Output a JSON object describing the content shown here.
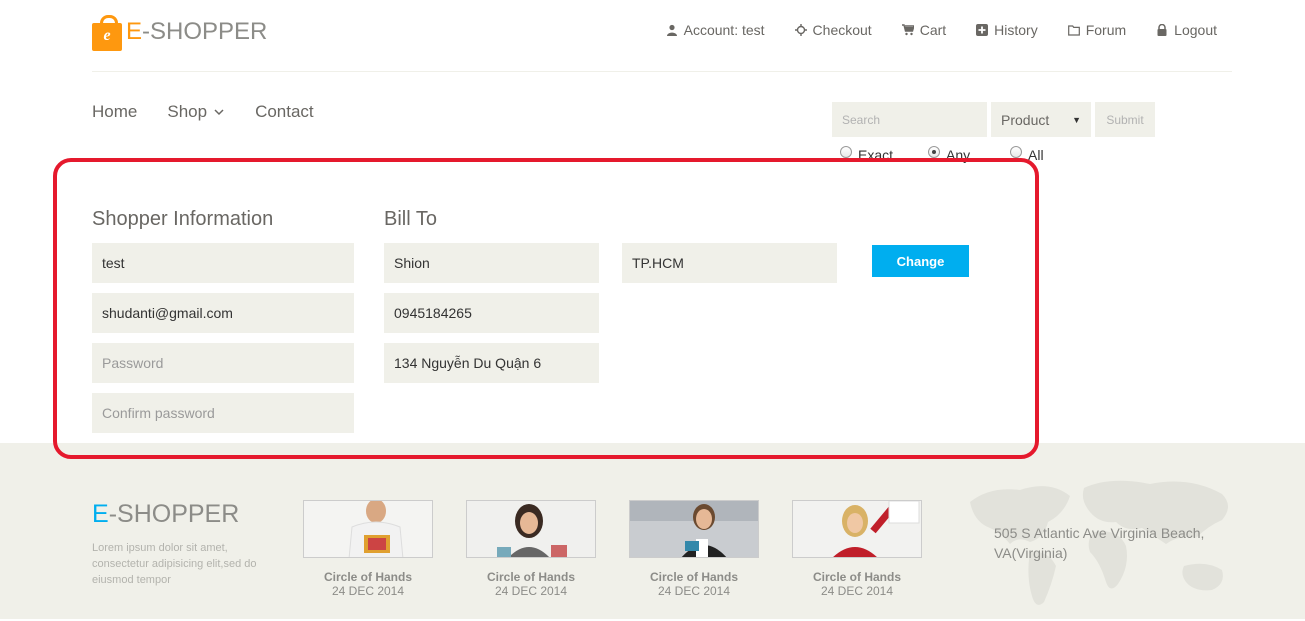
{
  "header": {
    "logo": {
      "first": "E",
      "rest": "-SHOPPER",
      "badge": "e"
    },
    "top_links": [
      {
        "label": "Account: test",
        "icon": "user-icon"
      },
      {
        "label": "Checkout",
        "icon": "crosshairs-icon"
      },
      {
        "label": "Cart",
        "icon": "cart-icon"
      },
      {
        "label": "History",
        "icon": "plus-square-icon"
      },
      {
        "label": "Forum",
        "icon": "folder-icon"
      },
      {
        "label": "Logout",
        "icon": "lock-icon"
      }
    ]
  },
  "nav": {
    "items": [
      {
        "label": "Home"
      },
      {
        "label": "Shop"
      },
      {
        "label": "Contact"
      }
    ]
  },
  "search": {
    "placeholder": "Search",
    "select_value": "Product",
    "submit_label": "Submit",
    "radio_options": [
      {
        "label": "Exact",
        "checked": false
      },
      {
        "label": "Any",
        "checked": true
      },
      {
        "label": "All",
        "checked": false
      }
    ]
  },
  "shopper_info": {
    "title": "Shopper Information",
    "username": "test",
    "email": "shudanti@gmail.com",
    "password_placeholder": "Password",
    "confirm_placeholder": "Confirm password"
  },
  "bill_to": {
    "title": "Bill To",
    "name": "Shion",
    "city": "TP.HCM",
    "phone": "0945184265",
    "address": "134 Nguyễn Du Quận 6",
    "change_label": "Change"
  },
  "footer": {
    "logo": {
      "first": "E",
      "rest": "-SHOPPER"
    },
    "description": "Lorem ipsum dolor sit amet, consectetur adipisicing elit,sed do eiusmod tempor",
    "cards": [
      {
        "caption": "Circle of Hands",
        "date": "24 DEC 2014"
      },
      {
        "caption": "Circle of Hands",
        "date": "24 DEC 2014"
      },
      {
        "caption": "Circle of Hands",
        "date": "24 DEC 2014"
      },
      {
        "caption": "Circle of Hands",
        "date": "24 DEC 2014"
      }
    ],
    "address": "505 S Atlantic Ave Virginia Beach, VA(Virginia)"
  },
  "colors": {
    "brand_orange": "#FE980F",
    "brand_blue": "#00AEEF",
    "highlight_red": "#E5192D",
    "field_bg": "#F0F0E9"
  }
}
